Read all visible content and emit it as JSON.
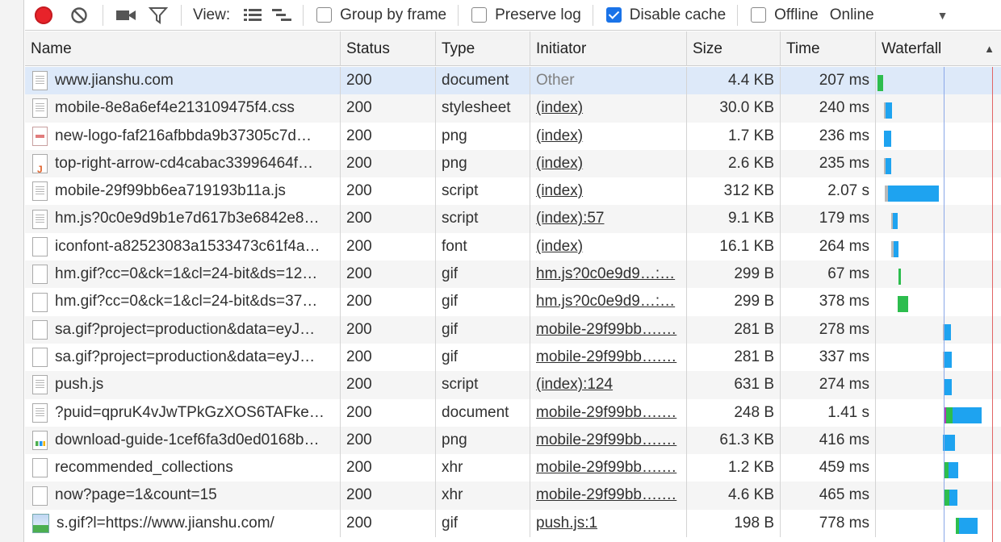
{
  "toolbar": {
    "view_label": "View:",
    "group_by_frame": "Group by frame",
    "group_by_frame_checked": false,
    "preserve_log": "Preserve log",
    "preserve_log_checked": false,
    "disable_cache": "Disable cache",
    "disable_cache_checked": true,
    "offline": "Offline",
    "offline_checked": false,
    "throttling": "Online"
  },
  "columns": {
    "name": "Name",
    "status": "Status",
    "type": "Type",
    "initiator": "Initiator",
    "size": "Size",
    "time": "Time",
    "waterfall": "Waterfall"
  },
  "rows": [
    {
      "name": "www.jianshu.com",
      "status": "200",
      "type": "document",
      "initiator": "Other",
      "initiator_link": false,
      "size": "4.4 KB",
      "time": "207 ms",
      "icon": "doc-icon"
    },
    {
      "name": "mobile-8e8a6ef4e213109475f4.css",
      "status": "200",
      "type": "stylesheet",
      "initiator": "(index)",
      "initiator_link": true,
      "size": "30.0 KB",
      "time": "240 ms",
      "icon": "doc-icon"
    },
    {
      "name": "new-logo-faf216afbbda9b37305c7d…",
      "status": "200",
      "type": "png",
      "initiator": "(index)",
      "initiator_link": true,
      "size": "1.7 KB",
      "time": "236 ms",
      "icon": "image-icon"
    },
    {
      "name": "top-right-arrow-cd4cabac33996464f…",
      "status": "200",
      "type": "png",
      "initiator": "(index)",
      "initiator_link": true,
      "size": "2.6 KB",
      "time": "235 ms",
      "icon": "image-icon"
    },
    {
      "name": "mobile-29f99bb6ea719193b11a.js",
      "status": "200",
      "type": "script",
      "initiator": "(index)",
      "initiator_link": true,
      "size": "312 KB",
      "time": "2.07 s",
      "icon": "doc-icon"
    },
    {
      "name": "hm.js?0c0e9d9b1e7d617b3e6842e8…",
      "status": "200",
      "type": "script",
      "initiator": "(index):57",
      "initiator_link": true,
      "size": "9.1 KB",
      "time": "179 ms",
      "icon": "doc-icon"
    },
    {
      "name": "iconfont-a82523083a1533473c61f4a…",
      "status": "200",
      "type": "font",
      "initiator": "(index)",
      "initiator_link": true,
      "size": "16.1 KB",
      "time": "264 ms",
      "icon": "blank-icon"
    },
    {
      "name": "hm.gif?cc=0&ck=1&cl=24-bit&ds=12…",
      "status": "200",
      "type": "gif",
      "initiator": "hm.js?0c0e9d9…:…",
      "initiator_link": true,
      "size": "299 B",
      "time": "67 ms",
      "icon": "blank-icon"
    },
    {
      "name": "hm.gif?cc=0&ck=1&cl=24-bit&ds=37…",
      "status": "200",
      "type": "gif",
      "initiator": "hm.js?0c0e9d9…:…",
      "initiator_link": true,
      "size": "299 B",
      "time": "378 ms",
      "icon": "blank-icon"
    },
    {
      "name": "sa.gif?project=production&data=eyJ…",
      "status": "200",
      "type": "gif",
      "initiator": "mobile-29f99bb….…",
      "initiator_link": true,
      "size": "281 B",
      "time": "278 ms",
      "icon": "blank-icon"
    },
    {
      "name": "sa.gif?project=production&data=eyJ…",
      "status": "200",
      "type": "gif",
      "initiator": "mobile-29f99bb….…",
      "initiator_link": true,
      "size": "281 B",
      "time": "337 ms",
      "icon": "blank-icon"
    },
    {
      "name": "push.js",
      "status": "200",
      "type": "script",
      "initiator": "(index):124",
      "initiator_link": true,
      "size": "631 B",
      "time": "274 ms",
      "icon": "doc-icon"
    },
    {
      "name": "?puid=qpruK4vJwTPkGzXOS6TAFke…",
      "status": "200",
      "type": "document",
      "initiator": "mobile-29f99bb….…",
      "initiator_link": true,
      "size": "248 B",
      "time": "1.41 s",
      "icon": "doc-icon"
    },
    {
      "name": "download-guide-1cef6fa3d0ed0168b…",
      "status": "200",
      "type": "png",
      "initiator": "mobile-29f99bb….…",
      "initiator_link": true,
      "size": "61.3 KB",
      "time": "416 ms",
      "icon": "chart-icon"
    },
    {
      "name": "recommended_collections",
      "status": "200",
      "type": "xhr",
      "initiator": "mobile-29f99bb….…",
      "initiator_link": true,
      "size": "1.2 KB",
      "time": "459 ms",
      "icon": "blank-icon"
    },
    {
      "name": "now?page=1&count=15",
      "status": "200",
      "type": "xhr",
      "initiator": "mobile-29f99bb….…",
      "initiator_link": true,
      "size": "4.6 KB",
      "time": "465 ms",
      "icon": "blank-icon"
    },
    {
      "name": "s.gif?l=https://www.jianshu.com/",
      "status": "200",
      "type": "gif",
      "initiator": "push.js:1",
      "initiator_link": true,
      "size": "198 B",
      "time": "778 ms",
      "icon": "picture-icon"
    }
  ]
}
